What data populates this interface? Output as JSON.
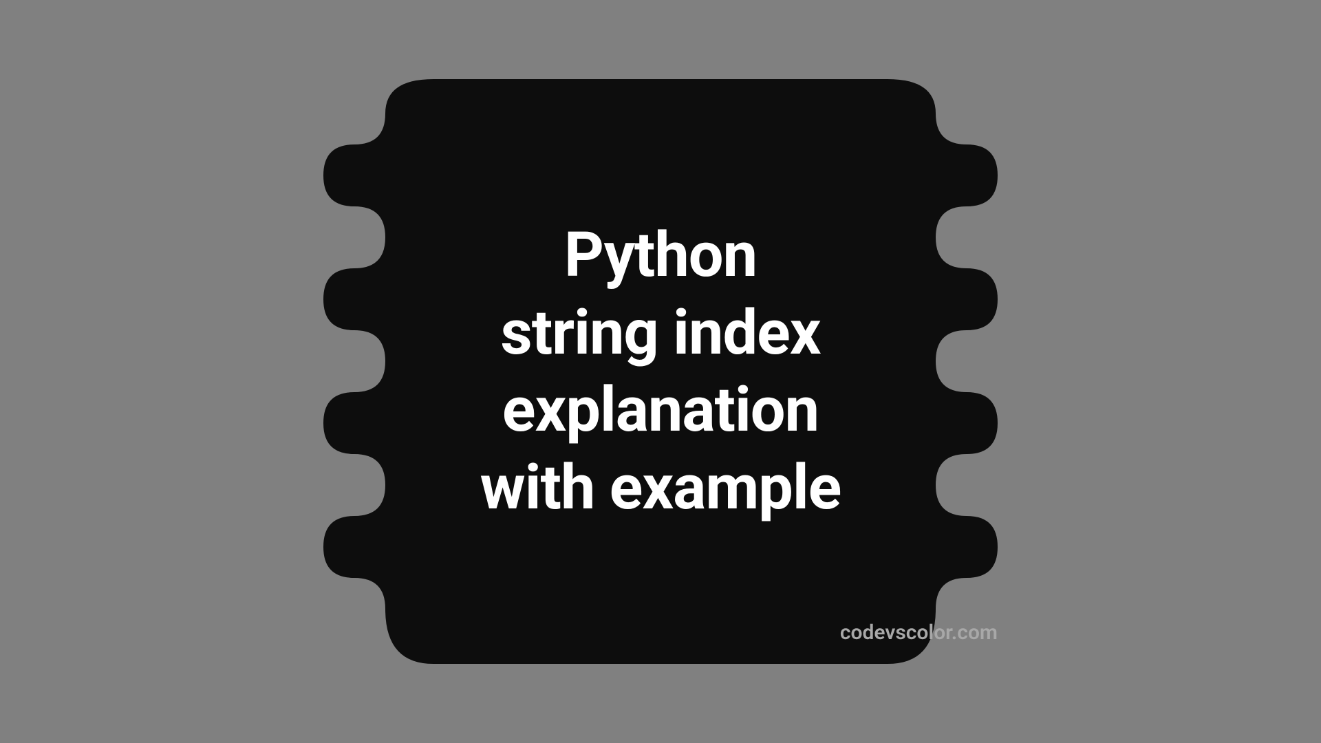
{
  "title": {
    "line1": "Python",
    "line2": "string index",
    "line3": "explanation",
    "line4": "with example"
  },
  "attribution": "codevscolor.com",
  "colors": {
    "background": "#808080",
    "blob": "#0d0d0d",
    "text": "#ffffff",
    "attribution": "#a8a8a8"
  }
}
